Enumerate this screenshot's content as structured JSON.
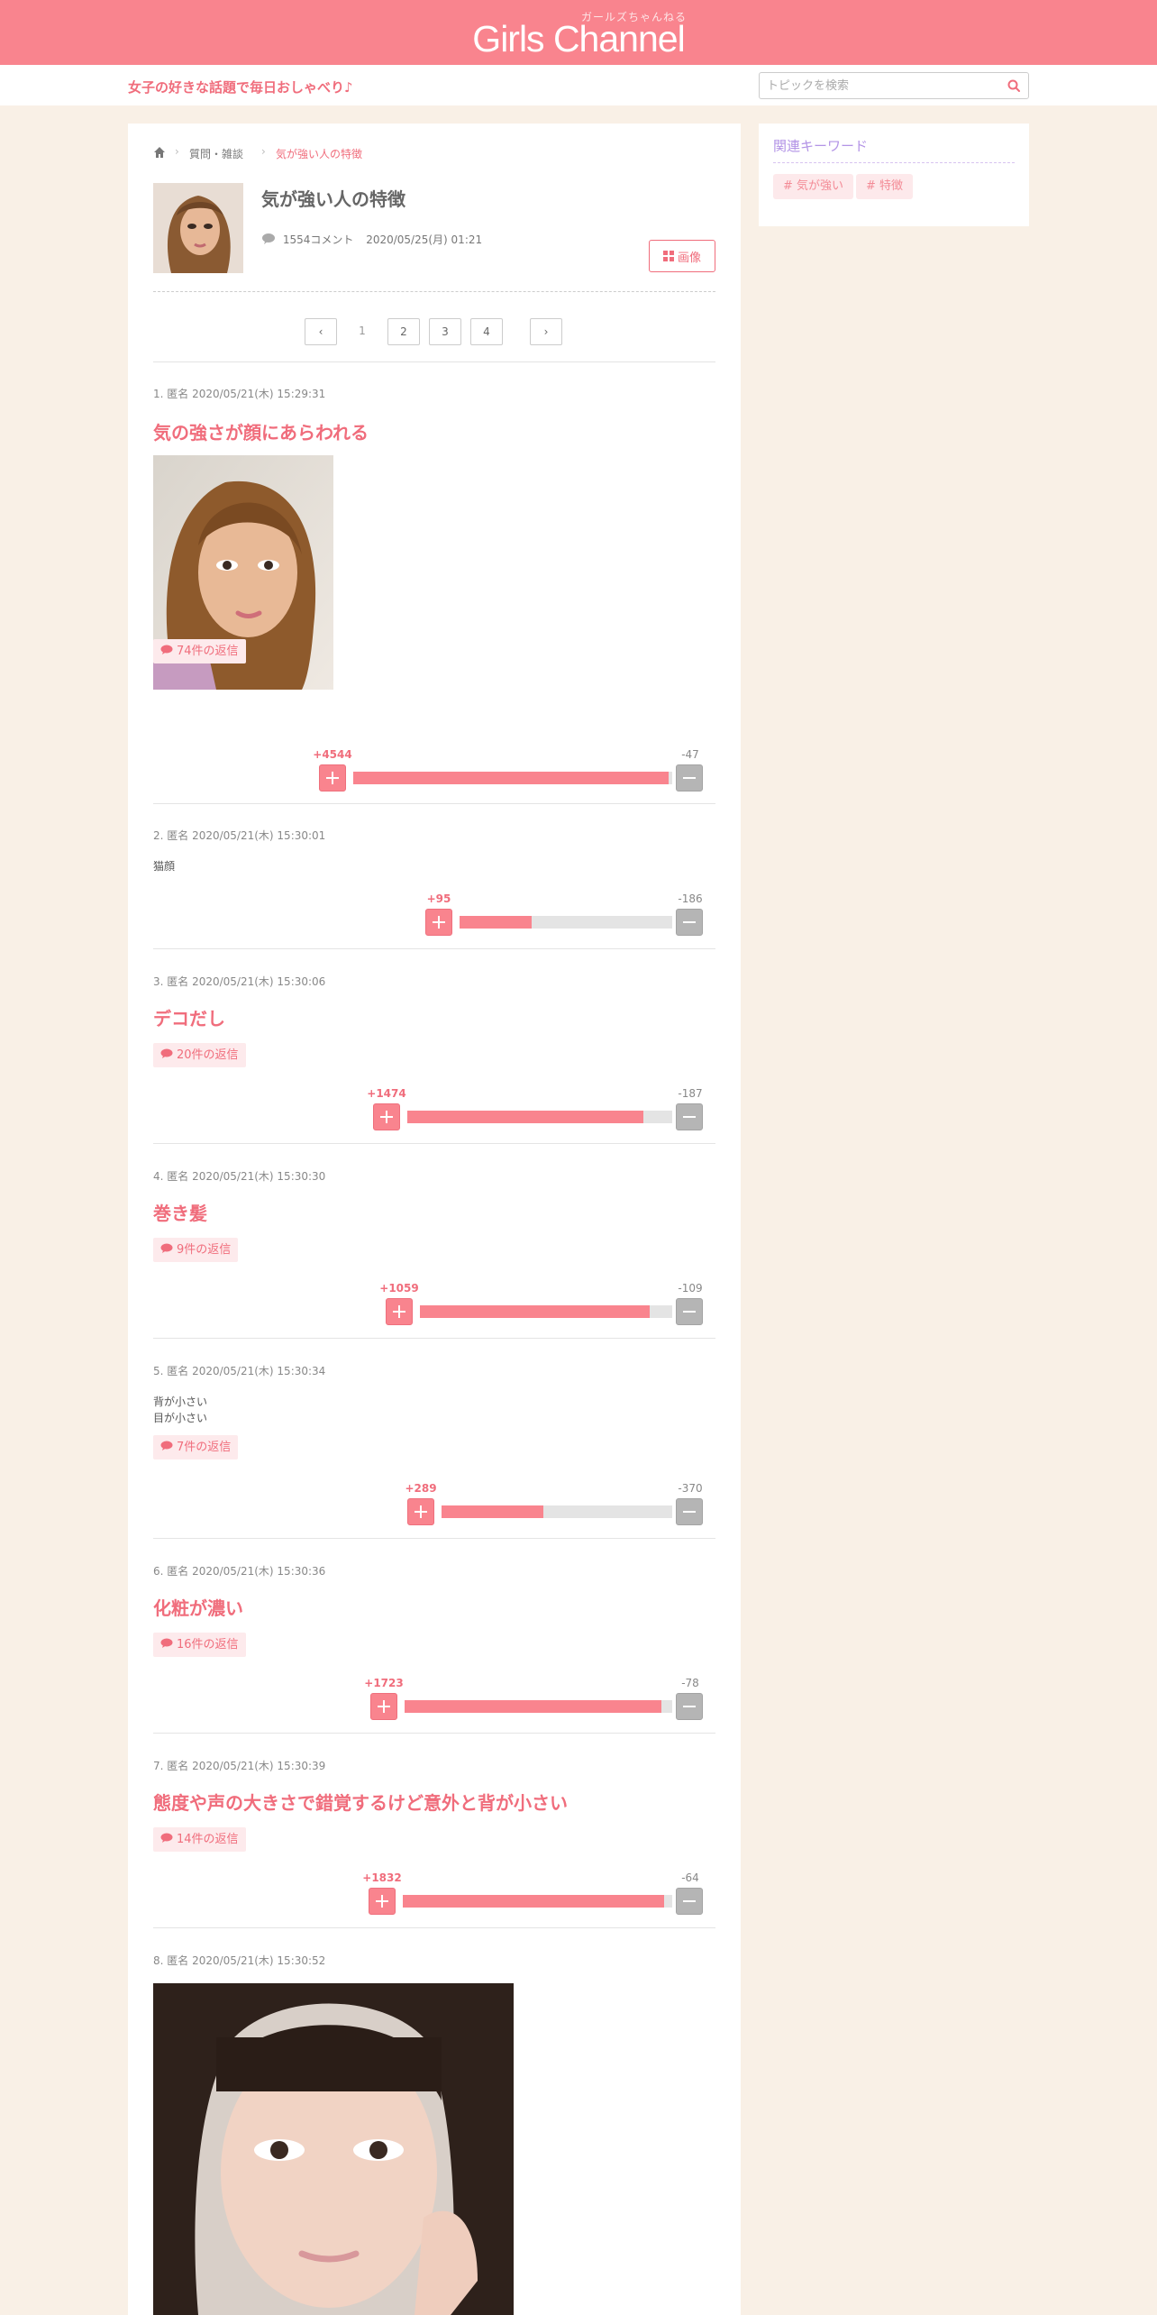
{
  "site": {
    "logo_kana": "ガールズちゃんねる",
    "logo_text": "Girls Channel",
    "tagline": "女子の好きな話題で毎日おしゃべり♪",
    "search_placeholder": "トピックを検索",
    "colors": {
      "brand": "#f9848e",
      "accent": "#f06d7c",
      "keyword_title": "#b394e6"
    }
  },
  "breadcrumb": [
    "質問・雑談",
    "気が強い人の特徴"
  ],
  "topic": {
    "title": "気が強い人の特徴",
    "comment_count": "1554コメント",
    "date": "2020/05/25(月) 01:21",
    "image_button": "画像"
  },
  "pagination": {
    "prev": "‹",
    "pages": [
      "1",
      "2",
      "3",
      "4"
    ],
    "current": "1",
    "next": "›"
  },
  "sidebar": {
    "title": "関連キーワード",
    "keywords": [
      "# 気が強い",
      "# 特徴"
    ]
  },
  "comments": [
    {
      "header": "1. 匿名 2020/05/21(木) 15:29:31",
      "title": "気の強さが顔にあらわれる",
      "replies": "74件の返信",
      "plus": "+4544",
      "minus": "-47",
      "ratio": 0.99
    },
    {
      "header": "2. 匿名 2020/05/21(木) 15:30:01",
      "body": "猫顔",
      "plus": "+95",
      "minus": "-186",
      "ratio": 0.34
    },
    {
      "header": "3. 匿名 2020/05/21(木) 15:30:06",
      "title": "デコだし",
      "replies": "20件の返信",
      "plus": "+1474",
      "minus": "-187",
      "ratio": 0.89
    },
    {
      "header": "4. 匿名 2020/05/21(木) 15:30:30",
      "title": "巻き髪",
      "replies": "9件の返信",
      "plus": "+1059",
      "minus": "-109",
      "ratio": 0.91
    },
    {
      "header": "5. 匿名 2020/05/21(木) 15:30:34",
      "body_lines": [
        "背が小さい",
        "目が小さい"
      ],
      "replies": "7件の返信",
      "plus": "+289",
      "minus": "-370",
      "ratio": 0.44
    },
    {
      "header": "6. 匿名 2020/05/21(木) 15:30:36",
      "title": "化粧が濃い",
      "replies": "16件の返信",
      "plus": "+1723",
      "minus": "-78",
      "ratio": 0.96
    },
    {
      "header": "7. 匿名 2020/05/21(木) 15:30:39",
      "title": "態度や声の大きさで錯覚するけど意外と背が小さい",
      "replies": "14件の返信",
      "plus": "+1832",
      "minus": "-64",
      "ratio": 0.97
    },
    {
      "header": "8. 匿名 2020/05/21(木) 15:30:52"
    }
  ]
}
